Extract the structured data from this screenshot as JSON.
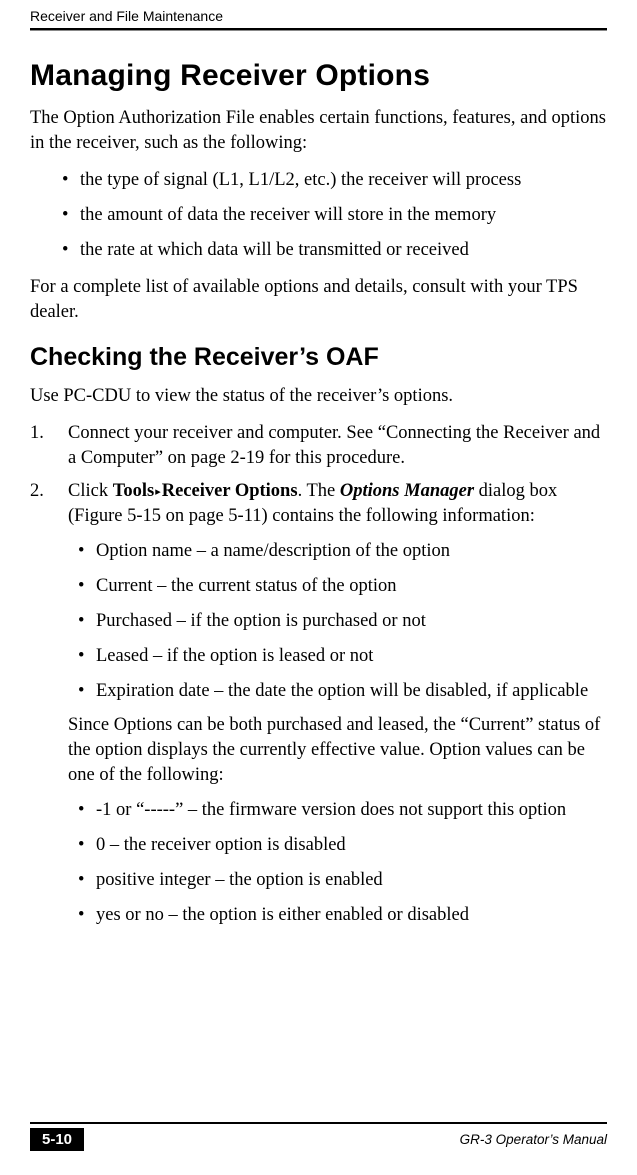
{
  "header": {
    "section": "Receiver and File Maintenance"
  },
  "h1": "Managing Receiver Options",
  "intro": "The Option Authorization File enables certain functions, features, and options in the receiver, such as the following:",
  "intro_bullets": [
    "the type of signal (L1, L1/L2, etc.) the receiver will process",
    "the amount of data the receiver will store in the memory",
    "the rate at which data will be transmitted or received"
  ],
  "intro_tail": "For a complete list of available options and details, consult with your TPS dealer.",
  "h2": "Checking the Receiver’s OAF",
  "h2_intro": "Use PC-CDU to view the status of the receiver’s options.",
  "step1": {
    "num": "1.",
    "text": "Connect your receiver and computer. See “Connecting the Receiver and a Computer” on page 2-19 for this procedure."
  },
  "step2": {
    "num": "2.",
    "lead": "Click ",
    "tools": "Tools",
    "arrow": "▸",
    "recv_opts": "Receiver Options",
    "after1": ". The ",
    "opts_mgr": "Options Manager",
    "after2": " dialog box (Figure 5-15 on page 5-11) contains the following information:",
    "fields": [
      "Option name – a name/description of the option",
      "Current – the current status of the option",
      "Purchased – if the option is purchased or not",
      "Leased – if the option is leased or not",
      "Expiration date – the date the option will be disabled, if applicable"
    ],
    "since_para": "Since Options can be both purchased and leased, the “Current” status of the option displays the currently effective value. Option values can be one of the following:",
    "values": [
      "-1 or “-----” – the firmware version does not support this option",
      "0 – the receiver option is disabled",
      "positive integer – the option is enabled",
      "yes or no – the option is either enabled or disabled"
    ]
  },
  "footer": {
    "page": "5-10",
    "manual": "GR-3 Operator’s Manual"
  }
}
